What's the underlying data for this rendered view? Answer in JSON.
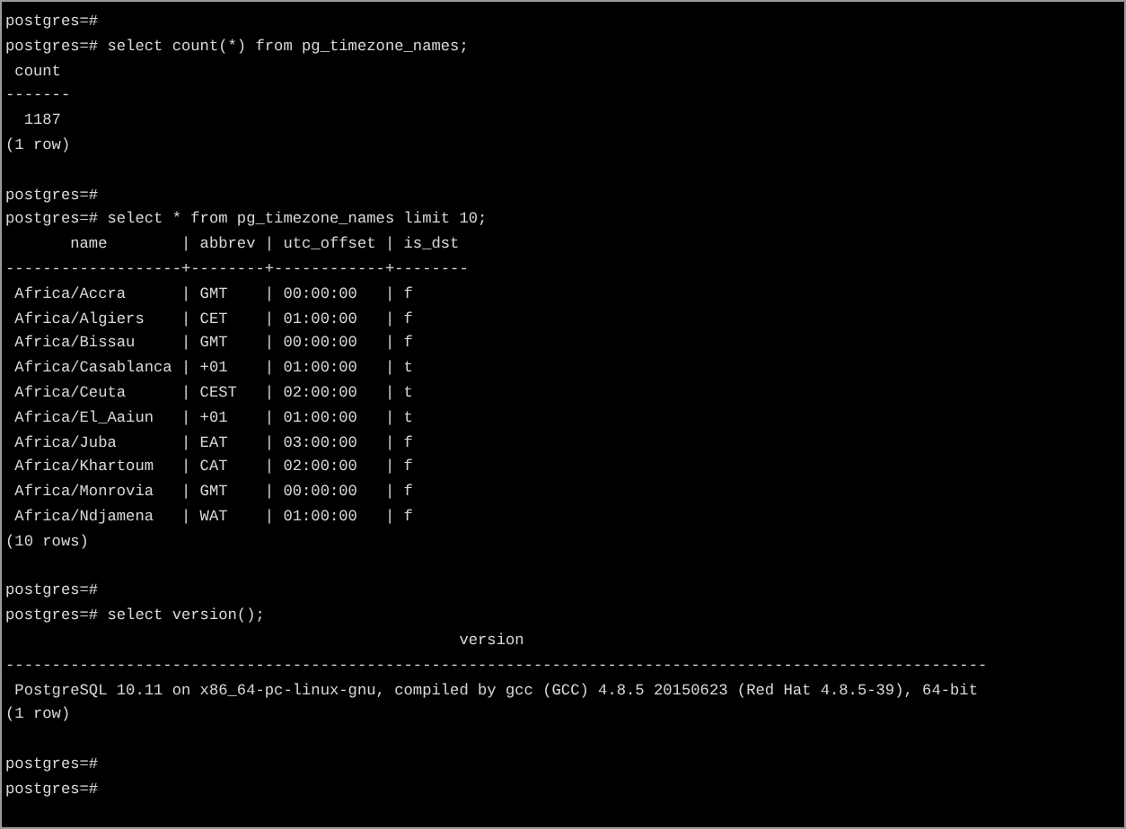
{
  "terminal": {
    "lines": [
      {
        "kind": "line",
        "text": "postgres=#"
      },
      {
        "kind": "line",
        "text": "postgres=# select count(*) from pg_timezone_names;"
      },
      {
        "kind": "line",
        "text": " count"
      },
      {
        "kind": "line",
        "text": "-------"
      },
      {
        "kind": "line",
        "text": "  1187"
      },
      {
        "kind": "line",
        "text": "(1 row)"
      },
      {
        "kind": "blank"
      },
      {
        "kind": "line",
        "text": "postgres=#"
      },
      {
        "kind": "line",
        "text": "postgres=# select * from pg_timezone_names limit 10;"
      },
      {
        "kind": "line",
        "text": "       name        | abbrev | utc_offset | is_dst"
      },
      {
        "kind": "line",
        "text": "-------------------+--------+------------+--------"
      },
      {
        "kind": "line",
        "text": " Africa/Accra      | GMT    | 00:00:00   | f"
      },
      {
        "kind": "line",
        "text": " Africa/Algiers    | CET    | 01:00:00   | f"
      },
      {
        "kind": "line",
        "text": " Africa/Bissau     | GMT    | 00:00:00   | f"
      },
      {
        "kind": "line",
        "text": " Africa/Casablanca | +01    | 01:00:00   | t"
      },
      {
        "kind": "line",
        "text": " Africa/Ceuta      | CEST   | 02:00:00   | t"
      },
      {
        "kind": "line",
        "text": " Africa/El_Aaiun   | +01    | 01:00:00   | t"
      },
      {
        "kind": "line",
        "text": " Africa/Juba       | EAT    | 03:00:00   | f"
      },
      {
        "kind": "line",
        "text": " Africa/Khartoum   | CAT    | 02:00:00   | f"
      },
      {
        "kind": "line",
        "text": " Africa/Monrovia   | GMT    | 00:00:00   | f"
      },
      {
        "kind": "line",
        "text": " Africa/Ndjamena   | WAT    | 01:00:00   | f"
      },
      {
        "kind": "line",
        "text": "(10 rows)"
      },
      {
        "kind": "blank"
      },
      {
        "kind": "line",
        "text": "postgres=#"
      },
      {
        "kind": "line",
        "text": "postgres=# select version();"
      },
      {
        "kind": "line",
        "text": "                                                 version"
      },
      {
        "kind": "line",
        "text": "----------------------------------------------------------------------------------------------------------"
      },
      {
        "kind": "line",
        "text": " PostgreSQL 10.11 on x86_64-pc-linux-gnu, compiled by gcc (GCC) 4.8.5 20150623 (Red Hat 4.8.5-39), 64-bit"
      },
      {
        "kind": "line",
        "text": "(1 row)"
      },
      {
        "kind": "blank"
      },
      {
        "kind": "line",
        "text": "postgres=#"
      },
      {
        "kind": "line",
        "text": "postgres=#"
      }
    ]
  }
}
